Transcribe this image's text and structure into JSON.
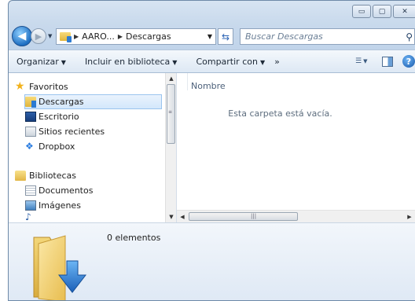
{
  "window": {
    "caption_buttons": [
      {
        "name": "minimize",
        "glyph": "▭"
      },
      {
        "name": "maximize",
        "glyph": "▢"
      },
      {
        "name": "close",
        "glyph": "✕"
      }
    ]
  },
  "address_bar": {
    "breadcrumb": [
      "AARO...",
      "Descargas"
    ],
    "search_placeholder": "Buscar Descargas"
  },
  "command_bar": {
    "organize": "Organizar",
    "include_in_library": "Incluir en biblioteca",
    "share_with": "Compartir con",
    "more": "»"
  },
  "nav_pane": {
    "favorites_label": "Favoritos",
    "favorites": [
      {
        "label": "Descargas",
        "icon": "downloads-folder-icon",
        "selected": true
      },
      {
        "label": "Escritorio",
        "icon": "desktop-icon",
        "selected": false
      },
      {
        "label": "Sitios recientes",
        "icon": "recent-places-icon",
        "selected": false
      },
      {
        "label": "Dropbox",
        "icon": "dropbox-icon",
        "selected": false
      }
    ],
    "libraries_label": "Bibliotecas",
    "libraries": [
      {
        "label": "Documentos",
        "icon": "documents-icon"
      },
      {
        "label": "Imágenes",
        "icon": "pictures-icon"
      }
    ]
  },
  "content": {
    "column_header": "Nombre",
    "empty_message": "Esta carpeta está vacía."
  },
  "details_pane": {
    "item_count": "0 elementos"
  },
  "colors": {
    "accent": "#2a7ad2",
    "selection": "#d3e7fb",
    "frame": "#bfd3ea"
  }
}
